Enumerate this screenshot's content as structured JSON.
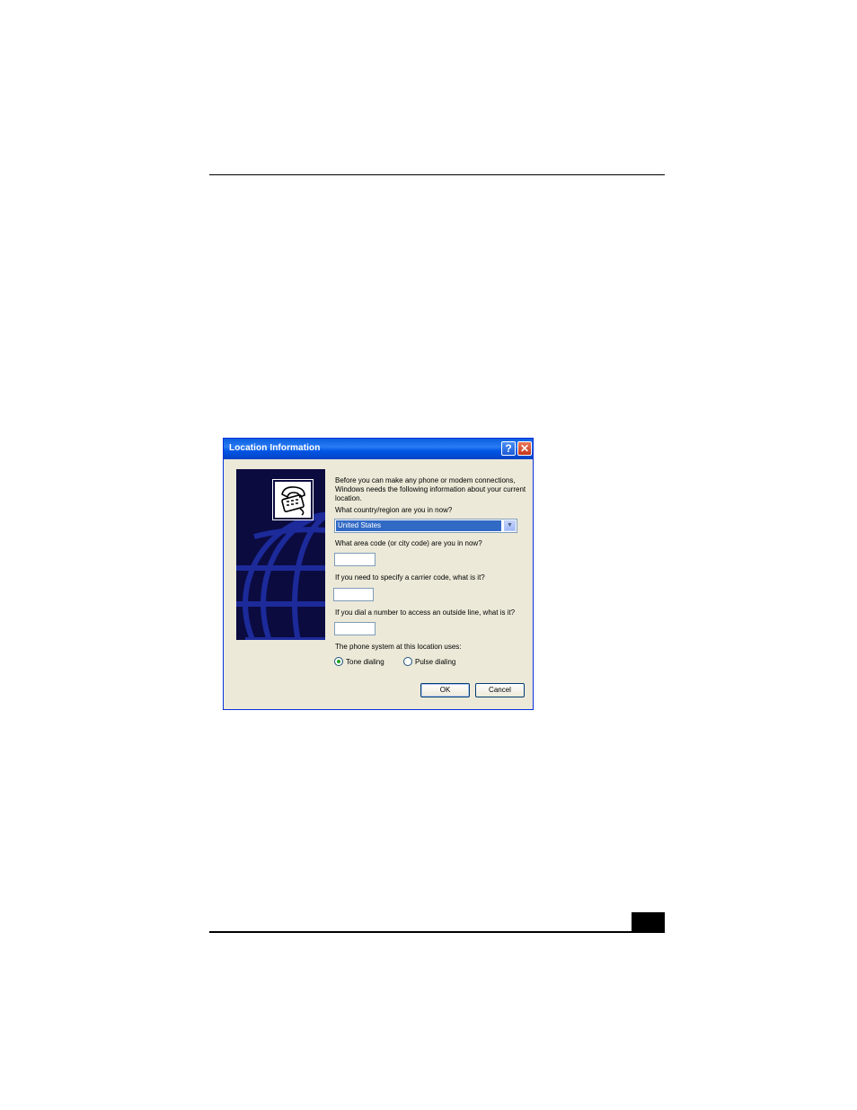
{
  "dialog": {
    "title": "Location Information",
    "help_label": "?",
    "close_label": "✕",
    "intro": "Before you can make any phone or modem connections, Windows needs the following information about your current location.",
    "country_label": "What country/region are you in now?",
    "country_value": "United States",
    "area_code_label": "What area code (or city code) are you in now?",
    "area_code_value": "",
    "carrier_label": "If you need to specify a carrier code, what is it?",
    "carrier_value": "",
    "outside_line_label": "If you dial a number to access an outside line, what is it?",
    "outside_line_value": "",
    "phone_system_label": "The phone system at this location uses:",
    "tone_label": "Tone dialing",
    "pulse_label": "Pulse dialing",
    "tone_selected": true,
    "ok_label": "OK",
    "cancel_label": "Cancel"
  },
  "icons": {
    "side_image": "globe-telephone",
    "phone": "telephone-icon",
    "dropdown": "chevron-down-icon"
  },
  "colors": {
    "titlebar": "#0a5fe0",
    "dialog_bg": "#ece9d8",
    "side_panel": "#0b0b40",
    "selection": "#316ac5"
  }
}
